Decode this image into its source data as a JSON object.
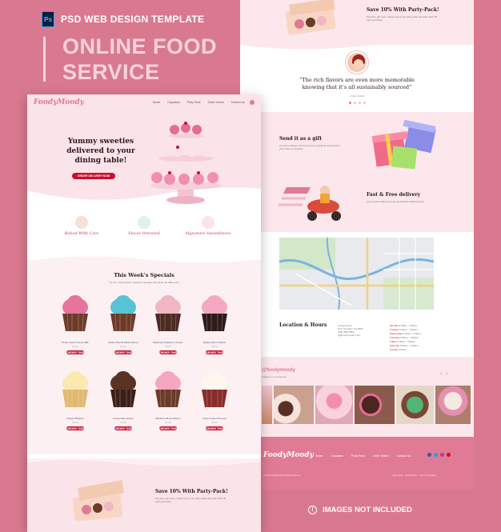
{
  "header": {
    "ps_badge": "Ps",
    "template_label": "PSD WEB DESIGN TEMPLATE",
    "title_line1": "ONLINE FOOD",
    "title_line2": "SERVICE"
  },
  "left_page": {
    "logo": "FoodyMoody",
    "nav": [
      "Home",
      "Cupcakes",
      "Party Pack",
      "Order Online",
      "Contact Us"
    ],
    "hero": {
      "title": "Yummy sweeties delivered to your dining table!",
      "cta": "ORDER DELIVERY NOW"
    },
    "features": [
      {
        "title": "Baked With Care",
        "icon": "chef-icon"
      },
      {
        "title": "Flavor Oriented",
        "icon": "cake-icon"
      },
      {
        "title": "Signature Smoothness",
        "icon": "cupcake-icon"
      }
    ],
    "specials": {
      "title": "This Week's Specials",
      "subtitle": "Try our most popular ingredient cupcakes and taste the difference!",
      "products": [
        {
          "name": "Pinky Cream Cherry Milk",
          "price": "$3.00",
          "cream": "#e8739b",
          "base": "#6b3b2a"
        },
        {
          "name": "Galaxy Biscuit Black Flavors",
          "price": "$3.00",
          "cream": "#58c3d6",
          "base": "#6b3b2a"
        },
        {
          "name": "Blushing Strawberry Cream",
          "price": "$3.00",
          "cream": "#f1b6c4",
          "base": "#4a2a22"
        },
        {
          "name": "Mystery Born Classic",
          "price": "$3.00",
          "cream": "#f4a9c0",
          "base": "#2e1a18"
        },
        {
          "name": "Classic Brighton",
          "price": "$3.00",
          "cream": "#fbe9b0",
          "base": "#e0b870"
        },
        {
          "name": "Cocoa Dark Dream",
          "price": "$3.00",
          "cream": "#5a3325",
          "base": "#3a2018"
        },
        {
          "name": "Rainbow Mixed Flavors",
          "price": "$3.00",
          "cream": "#f6a6c1",
          "base": "#6b3b2a"
        },
        {
          "name": "Velvet Grand Cherries",
          "price": "$3.00",
          "cream": "#fff6ee",
          "base": "#8a2a2a"
        }
      ],
      "order_label": "ORDER THIS"
    },
    "promo": {
      "title": "Save 10% With Party-Pack!",
      "text": "Pay less, get more. Select one of our party-pack and save 10% off each purchase."
    }
  },
  "right_page": {
    "promo": {
      "title": "Save 10% With Party-Pack!",
      "text": "Pay less, get more. Select one of our party-pack and save 10% off each purchase."
    },
    "testimonial": {
      "quote": "“The rich flavors are even more memorable knowing that it’s all sustainably sourced”",
      "author": "Amber Dolrell"
    },
    "gift": {
      "title": "Send it as a gift",
      "text": "Any item ordered. Send someone special an important to your order for surprise."
    },
    "delivery": {
      "title": "Fast & Free delivery",
      "text": "Lorem ipsum dolor sit amet consectetur adipiscing elit."
    },
    "location": {
      "title": "Location & Hours",
      "address": [
        "Foodymoody",
        "New Fountain, SA 8450",
        "(555) 555-5555",
        "hi@foodymoody.com"
      ],
      "hours": [
        {
          "day": "Monday",
          "time": "9:00am - 9:00pm"
        },
        {
          "day": "Tuesday",
          "time": "9:00am - 9:00pm"
        },
        {
          "day": "Wednesday",
          "time": "9:00am - 9:00pm"
        },
        {
          "day": "Thursday",
          "time": "9:00am - 9:00pm"
        },
        {
          "day": "Friday",
          "time": "9:00am - 9:00pm"
        },
        {
          "day": "Saturday",
          "time": "9:00am - 9:00pm"
        },
        {
          "day": "Sunday",
          "time": "Closed"
        }
      ]
    },
    "instagram": {
      "handle": "@foodymoody",
      "sub": "Follow us on Instagram"
    },
    "footer": {
      "logo": "FoodyMoody",
      "nav": [
        "Home",
        "Cupcakes",
        "Party Pack",
        "Order Online",
        "Contact Us"
      ],
      "copyright": "© 2020 FoodyMoody. All Rights Reserved.",
      "legal": "Legal Notice   ·   Privacy Policy   ·   Terms & Conditions"
    }
  },
  "note": "IMAGES NOT INCLUDED",
  "colors": {
    "background": "#d9798f",
    "accent": "#c8102e",
    "pink_light": "#fbe3ea",
    "logo": "#e07a95"
  }
}
